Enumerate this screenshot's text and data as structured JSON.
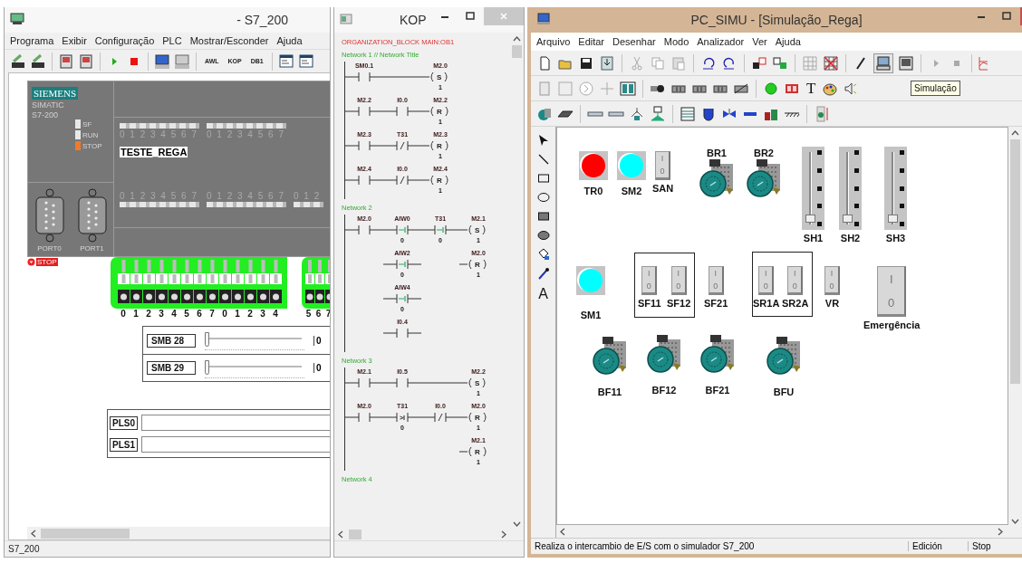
{
  "left_window": {
    "title": "- S7_200",
    "menu": [
      "Programa",
      "Exibir",
      "Configuração",
      "PLC",
      "Mostrar/Esconder",
      "Ajuda"
    ],
    "toolbar_labels": [
      "AWL",
      "KOP",
      "DB1"
    ],
    "plc": {
      "brand": "SIEMENS",
      "model_lines": [
        "SIMATIC",
        "S7-200"
      ],
      "leds": [
        {
          "label": "SF",
          "on": false
        },
        {
          "label": "RUN",
          "on": false
        },
        {
          "label": "STOP",
          "on": true
        }
      ],
      "input_digit_groups": [
        "0 1 2 3 4 5 6 7",
        "0 1 2 3 4 5 6 7"
      ],
      "program_name": "TESTE_REGA",
      "output_digit_groups": [
        "0 1 2 3 4 5 6 7",
        "0 1 2 3 4 5 6 7",
        "0 1 2"
      ],
      "ports": [
        "PORT0",
        "PORT1"
      ],
      "status": "STOP"
    },
    "input_switch_groups": [
      {
        "switches": [
          {
            "label": "0",
            "on": false
          },
          {
            "label": "1",
            "on": false
          },
          {
            "label": "2",
            "on": false
          },
          {
            "label": "3",
            "on": false
          },
          {
            "label": "4",
            "on": false
          },
          {
            "label": "5",
            "on": false
          },
          {
            "label": "6",
            "on": false
          },
          {
            "label": "7",
            "on": false
          },
          {
            "label": "0",
            "on": false
          },
          {
            "label": "1",
            "on": false
          },
          {
            "label": "2",
            "on": false
          },
          {
            "label": "3",
            "on": false
          },
          {
            "label": "4",
            "on": false
          }
        ]
      },
      {
        "switches": [
          {
            "label": "5",
            "on": false
          },
          {
            "label": "6",
            "on": false
          },
          {
            "label": "7",
            "on": false
          }
        ]
      }
    ],
    "analog_inputs": [
      {
        "label": "SMB 28",
        "level": 0,
        "value": "0"
      },
      {
        "label": "SMB 29",
        "level": 0,
        "value": "0"
      }
    ],
    "pulse_outputs": [
      "PLS0",
      "PLS1"
    ],
    "status_bar": "S7_200"
  },
  "kop_window": {
    "title": "KOP",
    "block_title": "ORGANIZATION_BLOCK MAIN:OB1",
    "networks": [
      {
        "title": "Network 1 // Network Title",
        "rows": [
          [
            {
              "kind": "no",
              "label": "SM0.1"
            },
            {
              "kind": "wire"
            },
            {
              "kind": "coil",
              "label": "M2.0",
              "letter": "S",
              "value": "1"
            }
          ],
          [
            {
              "kind": "no",
              "label": "M2.2"
            },
            {
              "kind": "no",
              "label": "I0.0"
            },
            {
              "kind": "coil",
              "label": "M2.2",
              "letter": "R",
              "value": "1"
            }
          ],
          [
            {
              "kind": "no",
              "label": "M2.3"
            },
            {
              "kind": "nc",
              "label": "T31"
            },
            {
              "kind": "coil",
              "label": "M2.3",
              "letter": "R",
              "value": "1"
            }
          ],
          [
            {
              "kind": "no",
              "label": "M2.4"
            },
            {
              "kind": "nc",
              "label": "I0.0"
            },
            {
              "kind": "coil",
              "label": "M2.4",
              "letter": "R",
              "value": "1"
            }
          ]
        ]
      },
      {
        "title": "Network 2",
        "rows": [
          [
            {
              "kind": "no",
              "label": "M2.0"
            },
            {
              "kind": "cmp",
              "label": "AIW0",
              "value": "0"
            },
            {
              "kind": "cmp",
              "label": "T31",
              "value": "0"
            },
            {
              "kind": "coil",
              "label": "M2.1",
              "letter": "S",
              "value": "1"
            }
          ],
          [
            {
              "kind": "empty"
            },
            {
              "kind": "cmp",
              "label": "AIW2",
              "value": "0"
            },
            {
              "kind": "empty"
            },
            {
              "kind": "coil",
              "label": "M2.0",
              "letter": "R",
              "value": "1"
            }
          ],
          [
            {
              "kind": "empty"
            },
            {
              "kind": "cmp",
              "label": "AIW4",
              "value": "0"
            },
            {
              "kind": "empty"
            },
            {
              "kind": "empty"
            }
          ],
          [
            {
              "kind": "empty"
            },
            {
              "kind": "no",
              "label": "I0.4"
            },
            {
              "kind": "empty"
            },
            {
              "kind": "empty"
            }
          ]
        ]
      },
      {
        "title": "Network 3",
        "rows": [
          [
            {
              "kind": "no",
              "label": "M2.1"
            },
            {
              "kind": "no",
              "label": "I0.5"
            },
            {
              "kind": "wire"
            },
            {
              "kind": "coil",
              "label": "M2.2",
              "letter": "S",
              "value": "1"
            }
          ],
          [
            {
              "kind": "no",
              "label": "M2.0"
            },
            {
              "kind": "cmp",
              "label": "T31",
              "op": ">I",
              "value": "0"
            },
            {
              "kind": "nc",
              "label": "I0.0"
            },
            {
              "kind": "coil",
              "label": "M2.0",
              "letter": "R",
              "value": "1"
            }
          ],
          [
            {
              "kind": "empty"
            },
            {
              "kind": "empty"
            },
            {
              "kind": "empty"
            },
            {
              "kind": "coil",
              "label": "M2.1",
              "letter": "R",
              "value": "1"
            }
          ]
        ]
      },
      {
        "title": "Network 4"
      }
    ]
  },
  "simu_window": {
    "title": "PC_SIMU - [Simulação_Rega]",
    "menu": [
      "Arquivo",
      "Editar",
      "Desenhar",
      "Modo",
      "Analizador",
      "Ver",
      "Ajuda"
    ],
    "text_tool": "T",
    "tooltip": "Simulação",
    "palette_text_tool": "A",
    "canvas": {
      "items": [
        {
          "kind": "lamp",
          "label": "TR0",
          "color": "#ff0000"
        },
        {
          "kind": "lamp",
          "label": "SM2",
          "color": "#00ffff"
        },
        {
          "kind": "switch",
          "label": "SAN",
          "on": false,
          "on_mark": "I",
          "off_mark": "0"
        },
        {
          "kind": "motor",
          "label": "BR1"
        },
        {
          "kind": "motor",
          "label": "BR2"
        },
        {
          "kind": "slider",
          "label": "SH1",
          "level": 0.05
        },
        {
          "kind": "slider",
          "label": "SH2",
          "level": 0.05
        },
        {
          "kind": "slider",
          "label": "SH3",
          "level": 0.05
        },
        {
          "kind": "lamp",
          "label": "SM1",
          "color": "#00ffff"
        },
        {
          "kind": "group"
        },
        {
          "kind": "switch",
          "label": "SF11",
          "on": false,
          "on_mark": "I",
          "off_mark": "0"
        },
        {
          "kind": "switch",
          "label": "SF12",
          "on": false,
          "on_mark": "I",
          "off_mark": "0"
        },
        {
          "kind": "switch",
          "label": "SF21",
          "on": false,
          "on_mark": "I",
          "off_mark": "0"
        },
        {
          "kind": "group"
        },
        {
          "kind": "switch",
          "label": "SR1A",
          "on": false,
          "on_mark": "I",
          "off_mark": "0"
        },
        {
          "kind": "switch",
          "label": "SR2A",
          "on": false,
          "on_mark": "I",
          "off_mark": "0"
        },
        {
          "kind": "switch",
          "label": "VR",
          "on": false,
          "on_mark": "I",
          "off_mark": "0"
        },
        {
          "kind": "big_switch",
          "label": "Emergência",
          "on": false,
          "on_mark": "I",
          "off_mark": "0"
        },
        {
          "kind": "motor",
          "label": "BF11"
        },
        {
          "kind": "motor",
          "label": "BF12"
        },
        {
          "kind": "motor",
          "label": "BF21"
        },
        {
          "kind": "motor",
          "label": "BFU"
        }
      ]
    },
    "status_bar": {
      "message": "Realiza o intercambio de E/S com o simulador S7_200",
      "mode": "Edición",
      "state": "Stop"
    }
  }
}
